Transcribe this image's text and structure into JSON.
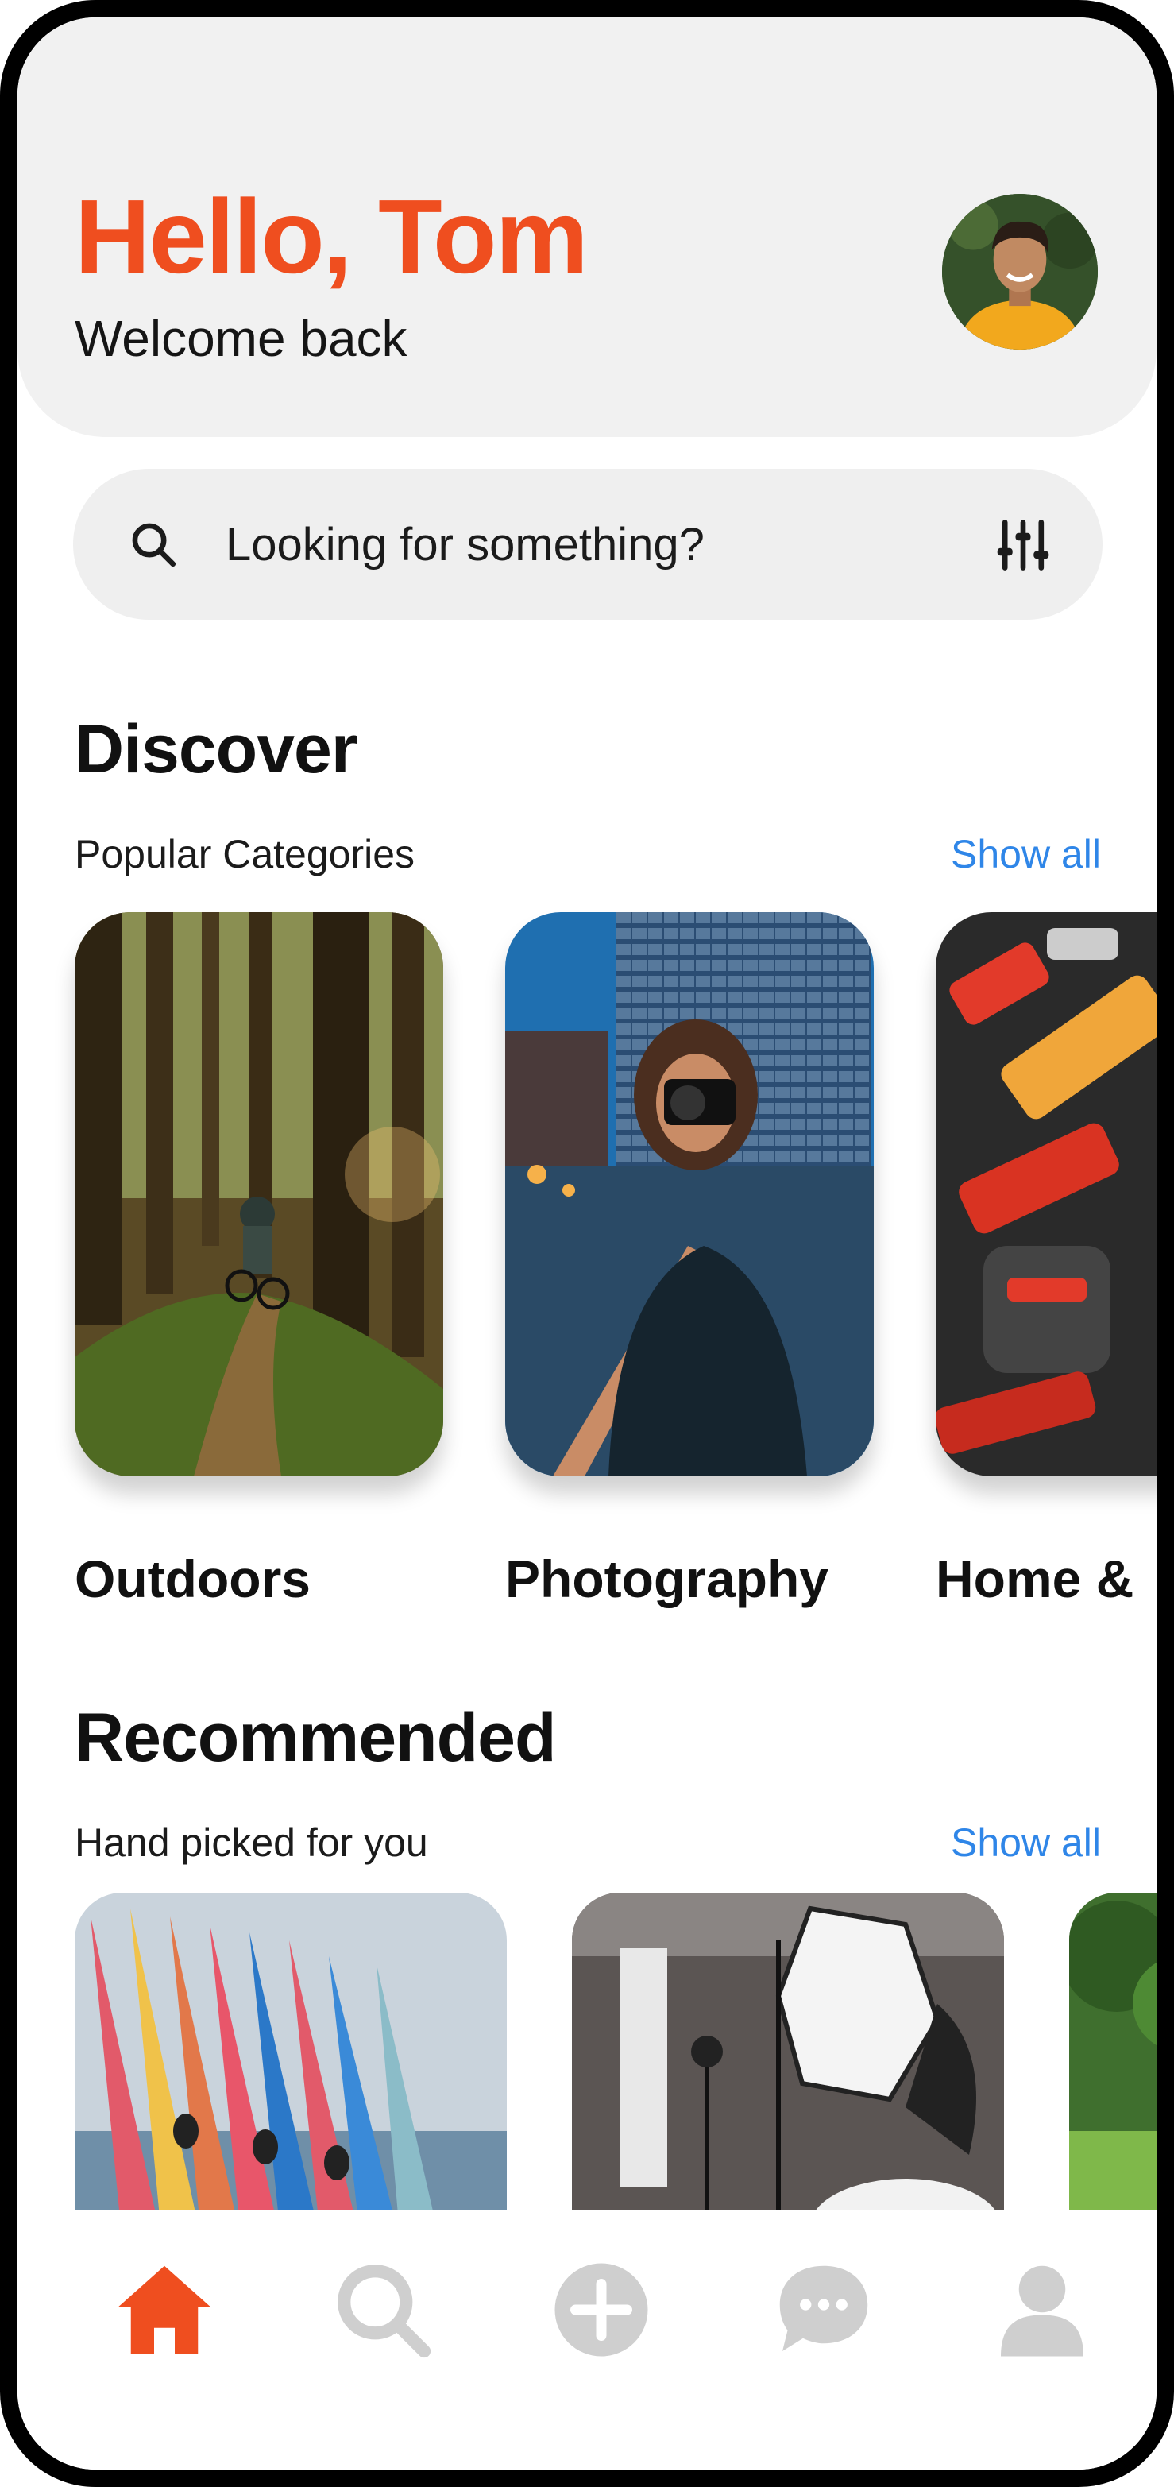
{
  "header": {
    "greeting": "Hello, Tom",
    "subtitle": "Welcome back"
  },
  "search": {
    "placeholder": "Looking for something?",
    "icon": "search-icon",
    "filter_icon": "sliders-icon"
  },
  "discover": {
    "title": "Discover",
    "subtitle": "Popular Categories",
    "show_all": "Show all",
    "categories": [
      {
        "label": "Outdoors",
        "image": "forest-cyclist"
      },
      {
        "label": "Photography",
        "image": "photographer-city"
      },
      {
        "label": "Home &",
        "image": "power-tools"
      }
    ]
  },
  "recommended": {
    "title": "Recommended",
    "subtitle": "Hand picked for you",
    "show_all": "Show all",
    "items": [
      {
        "image": "kayaks"
      },
      {
        "image": "photo-studio"
      },
      {
        "image": "garden"
      }
    ]
  },
  "tabbar": {
    "items": [
      {
        "icon": "home-icon",
        "active": true
      },
      {
        "icon": "search-icon",
        "active": false
      },
      {
        "icon": "add-icon",
        "active": false
      },
      {
        "icon": "chat-icon",
        "active": false
      },
      {
        "icon": "profile-icon",
        "active": false
      }
    ]
  },
  "colors": {
    "accent": "#ef4e1f",
    "link": "#2f86e8",
    "inactive_icon": "#cfcfcf",
    "surface": "#f1f1f1"
  }
}
